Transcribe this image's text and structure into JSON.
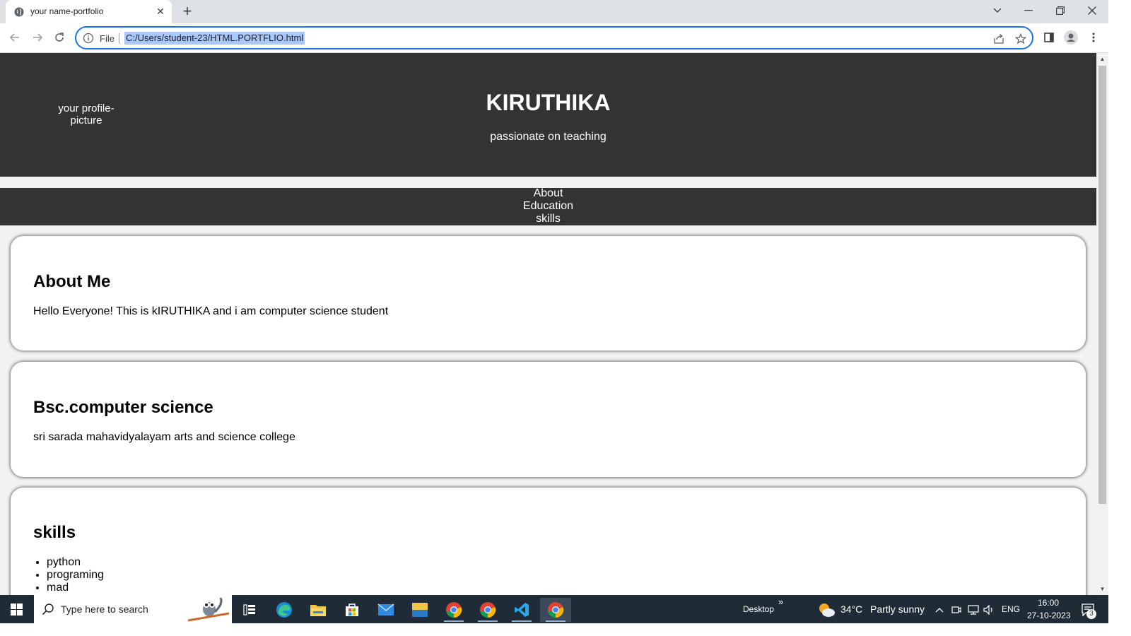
{
  "browser": {
    "tab_title": "your name-portfolio",
    "new_tab_symbol": "+",
    "close_symbol": "✕",
    "omnibox_file_label": "File",
    "url": "C:/Users/student-23/HTML.PORTFLIO.html",
    "accent_color": "#1a73e8"
  },
  "page": {
    "header": {
      "profile_picture_alt": "your profile-picture",
      "name": "KIRUTHIKA",
      "tagline": "passionate on teaching"
    },
    "nav": {
      "links": [
        "About",
        "Education",
        "skills"
      ]
    },
    "sections": {
      "about": {
        "heading": "About Me",
        "text": "Hello Everyone! This is kIRUTHIKA and i am computer science student"
      },
      "education": {
        "heading": "Bsc.computer science",
        "text": "sri sarada mahavidyalayam arts and science college"
      },
      "skills": {
        "heading": "skills",
        "items": [
          "python",
          "programing",
          "mad"
        ]
      }
    },
    "colors": {
      "header_bg": "#333333",
      "page_bg": "#f2f2f2",
      "card_bg": "#ffffff"
    }
  },
  "taskbar": {
    "search_placeholder": "Type here to search",
    "desktop_label": "Desktop",
    "weather_temp": "34°C",
    "weather_desc": "Partly sunny",
    "language": "ENG",
    "time": "16:00",
    "date": "27-10-2023",
    "notification_count": "3",
    "overflow_symbol": "»",
    "apps": [
      "task-view",
      "edge",
      "file-explorer",
      "microsoft-store",
      "mail",
      "photos",
      "chrome",
      "chrome",
      "vscode",
      "chrome"
    ]
  }
}
